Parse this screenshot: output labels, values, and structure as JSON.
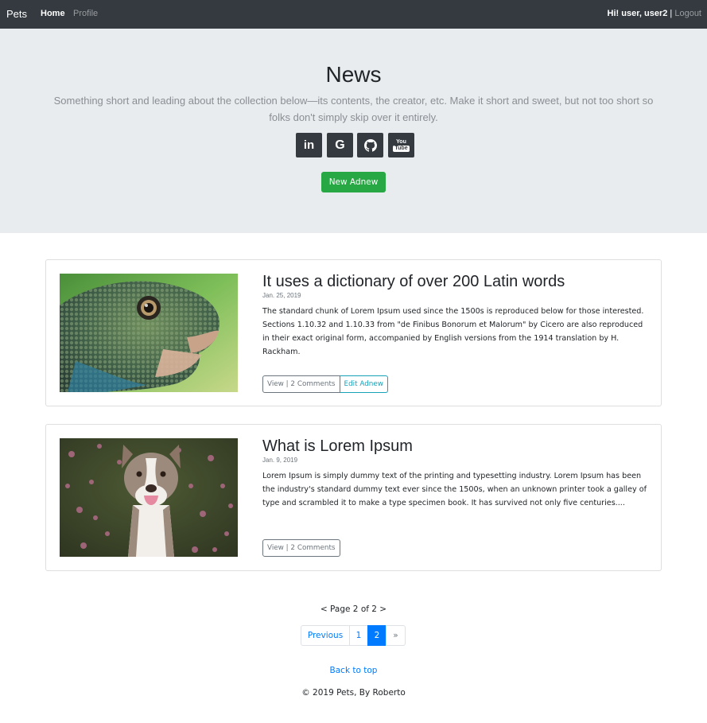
{
  "navbar": {
    "brand": "Pets",
    "links": [
      {
        "label": "Home",
        "active": true
      },
      {
        "label": "Profile",
        "active": false
      }
    ],
    "greeting": "Hi! user, user2",
    "separator": " | ",
    "logout_label": "Logout"
  },
  "hero": {
    "title": "News",
    "lead": "Something short and leading about the collection below—its contents, the creator, etc. Make it short and sweet, but not too short so folks don't simply skip over it entirely.",
    "socials": [
      {
        "icon": "linkedin-icon",
        "text": "in"
      },
      {
        "icon": "google-icon",
        "text": "G"
      },
      {
        "icon": "github-icon",
        "text": ""
      },
      {
        "icon": "youtube-icon",
        "text": "You Tube"
      }
    ],
    "new_button": "New Adnew"
  },
  "posts": [
    {
      "title": "It uses a dictionary of over 200 Latin words",
      "date": "Jan. 25, 2019",
      "body": "The standard chunk of Lorem Ipsum used since the 1500s is reproduced below for those interested. Sections 1.10.32 and 1.10.33 from \"de Finibus Bonorum et Malorum\" by Cicero are also reproduced in their exact original form, accompanied by English versions from the 1914 translation by H. Rackham.",
      "image": "iguana-photo",
      "view_label": "View | 2 Comments",
      "edit_label": "Edit Adnew"
    },
    {
      "title": "What is Lorem Ipsum",
      "date": "Jan. 9, 2019",
      "body": "Lorem Ipsum is simply dummy text of the printing and typesetting industry. Lorem Ipsum has been the industry's standard dummy text ever since the 1500s, when an unknown printer took a galley of type and scrambled it to make a type specimen book. It has survived not only five centuries....",
      "image": "dog-photo",
      "view_label": "View | 2 Comments"
    }
  ],
  "pagination": {
    "info": "< Page 2 of 2 >",
    "previous": "Previous",
    "pages": [
      "1",
      "2"
    ],
    "current": "2",
    "next": "»"
  },
  "footer": {
    "back_to_top": "Back to top",
    "copyright": "© 2019 Pets, By Roberto"
  },
  "colors": {
    "navbar": "#343a40",
    "hero_bg": "#e9ecef",
    "success": "#28a745",
    "primary": "#007bff",
    "info": "#17a2b8",
    "secondary": "#6c757d"
  }
}
